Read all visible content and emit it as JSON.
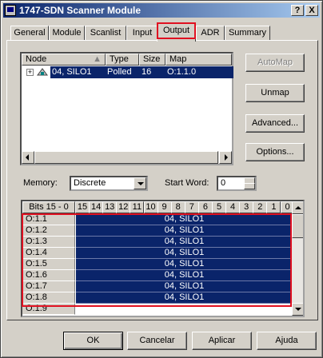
{
  "window": {
    "title": "1747-SDN Scanner Module",
    "help_btn": "?",
    "close_btn": "X"
  },
  "tabs": [
    {
      "label": "General"
    },
    {
      "label": "Module"
    },
    {
      "label": "Scanlist"
    },
    {
      "label": "Input"
    },
    {
      "label": "Output",
      "active": true
    },
    {
      "label": "ADR"
    },
    {
      "label": "Summary"
    }
  ],
  "device_list": {
    "columns": [
      "Node",
      "Type",
      "Size",
      "Map"
    ],
    "rows": [
      {
        "node": "04, SILO1",
        "type": "Polled",
        "size": "16",
        "map": "O:1.1.0",
        "selected": true
      }
    ]
  },
  "side_buttons": {
    "automap": "AutoMap",
    "unmap": "Unmap",
    "advanced": "Advanced...",
    "options": "Options..."
  },
  "memory": {
    "label": "Memory:",
    "value": "Discrete"
  },
  "start_word": {
    "label": "Start Word:",
    "value": "0"
  },
  "bit_grid": {
    "header_label": "Bits 15 - 0",
    "bits": [
      "15",
      "14",
      "13",
      "12",
      "11",
      "10",
      "9",
      "8",
      "7",
      "6",
      "5",
      "4",
      "3",
      "2",
      "1",
      "0"
    ],
    "rows": [
      {
        "word": "O:1.1",
        "value": "04, SILO1"
      },
      {
        "word": "O:1.2",
        "value": "04, SILO1"
      },
      {
        "word": "O:1.3",
        "value": "04, SILO1"
      },
      {
        "word": "O:1.4",
        "value": "04, SILO1"
      },
      {
        "word": "O:1.5",
        "value": "04, SILO1"
      },
      {
        "word": "O:1.6",
        "value": "04, SILO1"
      },
      {
        "word": "O:1.7",
        "value": "04, SILO1"
      },
      {
        "word": "O:1.8",
        "value": "04, SILO1"
      },
      {
        "word": "O:1.9",
        "value": ""
      }
    ]
  },
  "footer": {
    "ok": "OK",
    "cancel": "Cancelar",
    "apply": "Aplicar",
    "help": "Ajuda"
  },
  "colors": {
    "selection": "#0a246a",
    "highlight_box": "#e01020",
    "face": "#d4d0c8"
  }
}
